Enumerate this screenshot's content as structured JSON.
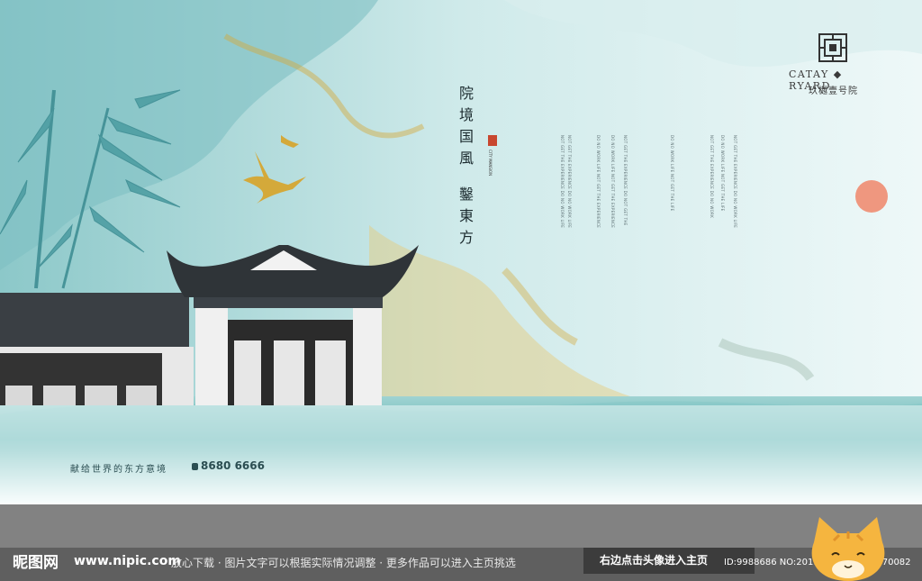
{
  "headline": {
    "chars_group1": [
      "院",
      "境",
      "国",
      "風"
    ],
    "chars_group2": [
      "鑿",
      "東",
      "方"
    ]
  },
  "seal_text": "CITY MANSION",
  "english_columns": [
    "NOT GET THE EXPERIENCE DO NO WORK LIFE",
    "NOT GET THE EXPERIENCE DO NO WORK LIFE",
    "DO NO WORK LIFE NOT GET THE EXPERIENCE",
    "DO NO WORK LIFE NOT GET THE EXPERIENCE",
    "NOT GET THE EXPERIENCE DO NOT GET THE",
    "DO NO WORK LIFE NOT GET THE LIFE",
    "NOT GET THE EXPERIENCE DO NO WORK",
    "DO NO WORK LIFE NOT GET THE LIFE",
    "NOT GET THE EXPERIENCE DO NO WORK LIFE"
  ],
  "brand": {
    "en": "CATAY ◆ RYARD",
    "cn": "玖樾壹号院"
  },
  "slogan": "献给世界的东方意境",
  "phone": "8680 6666",
  "footer": {
    "logo": "昵图网",
    "site": "www.nipic.com",
    "notice": "放心下载 · 图片文字可以根据实际情况调整 · 更多作品可以进入主页挑选",
    "click_label": "右边点击头像进入主页",
    "ids": "ID:9988686 NO:20190831160828970082"
  },
  "colors": {
    "accent_gold": "#d4a93a",
    "seal_red": "#c8472f",
    "roof": "#2f3438",
    "teal": "#6ab9b9"
  }
}
